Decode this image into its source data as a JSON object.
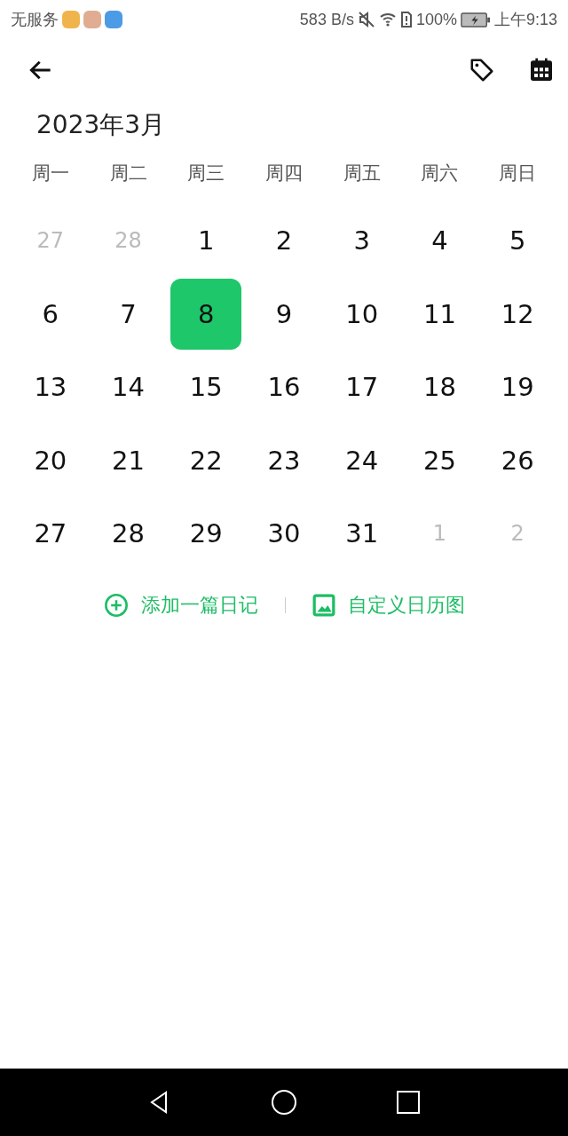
{
  "status_bar": {
    "carrier": "无服务",
    "speed": "583 B/s",
    "battery": "100%",
    "time": "上午9:13"
  },
  "month_title": "2023年3月",
  "weekdays": [
    "周一",
    "周二",
    "周三",
    "周四",
    "周五",
    "周六",
    "周日"
  ],
  "days": [
    {
      "label": "27",
      "muted": true,
      "selected": false
    },
    {
      "label": "28",
      "muted": true,
      "selected": false
    },
    {
      "label": "1",
      "muted": false,
      "selected": false
    },
    {
      "label": "2",
      "muted": false,
      "selected": false
    },
    {
      "label": "3",
      "muted": false,
      "selected": false
    },
    {
      "label": "4",
      "muted": false,
      "selected": false
    },
    {
      "label": "5",
      "muted": false,
      "selected": false
    },
    {
      "label": "6",
      "muted": false,
      "selected": false
    },
    {
      "label": "7",
      "muted": false,
      "selected": false
    },
    {
      "label": "8",
      "muted": false,
      "selected": true
    },
    {
      "label": "9",
      "muted": false,
      "selected": false
    },
    {
      "label": "10",
      "muted": false,
      "selected": false
    },
    {
      "label": "11",
      "muted": false,
      "selected": false
    },
    {
      "label": "12",
      "muted": false,
      "selected": false
    },
    {
      "label": "13",
      "muted": false,
      "selected": false
    },
    {
      "label": "14",
      "muted": false,
      "selected": false
    },
    {
      "label": "15",
      "muted": false,
      "selected": false
    },
    {
      "label": "16",
      "muted": false,
      "selected": false
    },
    {
      "label": "17",
      "muted": false,
      "selected": false
    },
    {
      "label": "18",
      "muted": false,
      "selected": false
    },
    {
      "label": "19",
      "muted": false,
      "selected": false
    },
    {
      "label": "20",
      "muted": false,
      "selected": false
    },
    {
      "label": "21",
      "muted": false,
      "selected": false
    },
    {
      "label": "22",
      "muted": false,
      "selected": false
    },
    {
      "label": "23",
      "muted": false,
      "selected": false
    },
    {
      "label": "24",
      "muted": false,
      "selected": false
    },
    {
      "label": "25",
      "muted": false,
      "selected": false
    },
    {
      "label": "26",
      "muted": false,
      "selected": false
    },
    {
      "label": "27",
      "muted": false,
      "selected": false
    },
    {
      "label": "28",
      "muted": false,
      "selected": false
    },
    {
      "label": "29",
      "muted": false,
      "selected": false
    },
    {
      "label": "30",
      "muted": false,
      "selected": false
    },
    {
      "label": "31",
      "muted": false,
      "selected": false
    },
    {
      "label": "1",
      "muted": true,
      "selected": false
    },
    {
      "label": "2",
      "muted": true,
      "selected": false
    }
  ],
  "actions": [
    {
      "kind": "add",
      "label": "添加一篇日记"
    },
    {
      "kind": "image",
      "label": "自定义日历图"
    }
  ]
}
